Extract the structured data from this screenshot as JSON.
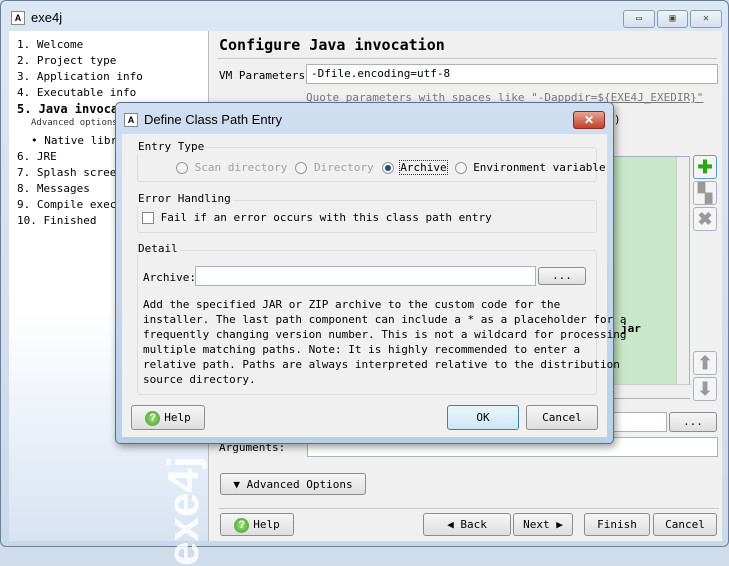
{
  "window": {
    "title": "exe4j",
    "icon": "app-icon",
    "controls": [
      "minimize-icon",
      "maximize-icon",
      "close-icon"
    ]
  },
  "sidebar": {
    "steps": [
      {
        "label": "1. Welcome"
      },
      {
        "label": "2. Project type"
      },
      {
        "label": "3. Application info"
      },
      {
        "label": "4. Executable info"
      },
      {
        "label": "5. Java invoca",
        "current": true
      },
      {
        "label": "Advanced options:",
        "sub": true
      },
      {
        "label": "• Native libra"
      },
      {
        "label": "6. JRE"
      },
      {
        "label": "7. Splash screen"
      },
      {
        "label": "8. Messages"
      },
      {
        "label": "9. Compile execu"
      },
      {
        "label": "10. Finished"
      }
    ],
    "watermark": "exe4j"
  },
  "main": {
    "title": "Configure Java invocation",
    "vm_label": "VM Parameters:",
    "vm_value": "-Dfile.encoding=utf-8",
    "hint": "Quote parameters with spaces like \"-Dappdir=${EXE4J_EXEDIR}\"",
    "paren": ")",
    "list_fragment": "jar",
    "browse": "...",
    "args_label": "Arguments:",
    "advanced": "Advanced Options",
    "help": "Help",
    "back": "Back",
    "next": "Next",
    "finish": "Finish",
    "cancel": "Cancel"
  },
  "dialog": {
    "title": "Define Class Path Entry",
    "entry_type": {
      "label": "Entry Type",
      "options": [
        {
          "label": "Scan directory",
          "enabled": false,
          "selected": false
        },
        {
          "label": "Directory",
          "enabled": false,
          "selected": false
        },
        {
          "label": "Archive",
          "enabled": true,
          "selected": true
        },
        {
          "label": "Environment variable",
          "enabled": true,
          "selected": false
        }
      ]
    },
    "error_handling": {
      "label": "Error Handling",
      "checkbox": "Fail if an error occurs with this class path entry",
      "checked": false
    },
    "detail": {
      "label": "Detail",
      "archive_label": "Archive:",
      "archive_value": "",
      "browse": "...",
      "description": [
        "Add the specified JAR or ZIP archive to the custom code for the",
        "installer. The last path component can include a * as a placeholder for a",
        "frequently changing version number. This is not a wildcard for processing",
        "multiple matching paths. Note: It is highly recommended to enter a",
        "relative path. Paths are always interpreted relative to the distribution",
        "source directory."
      ]
    },
    "help": "Help",
    "ok": "OK",
    "cancel": "Cancel"
  }
}
